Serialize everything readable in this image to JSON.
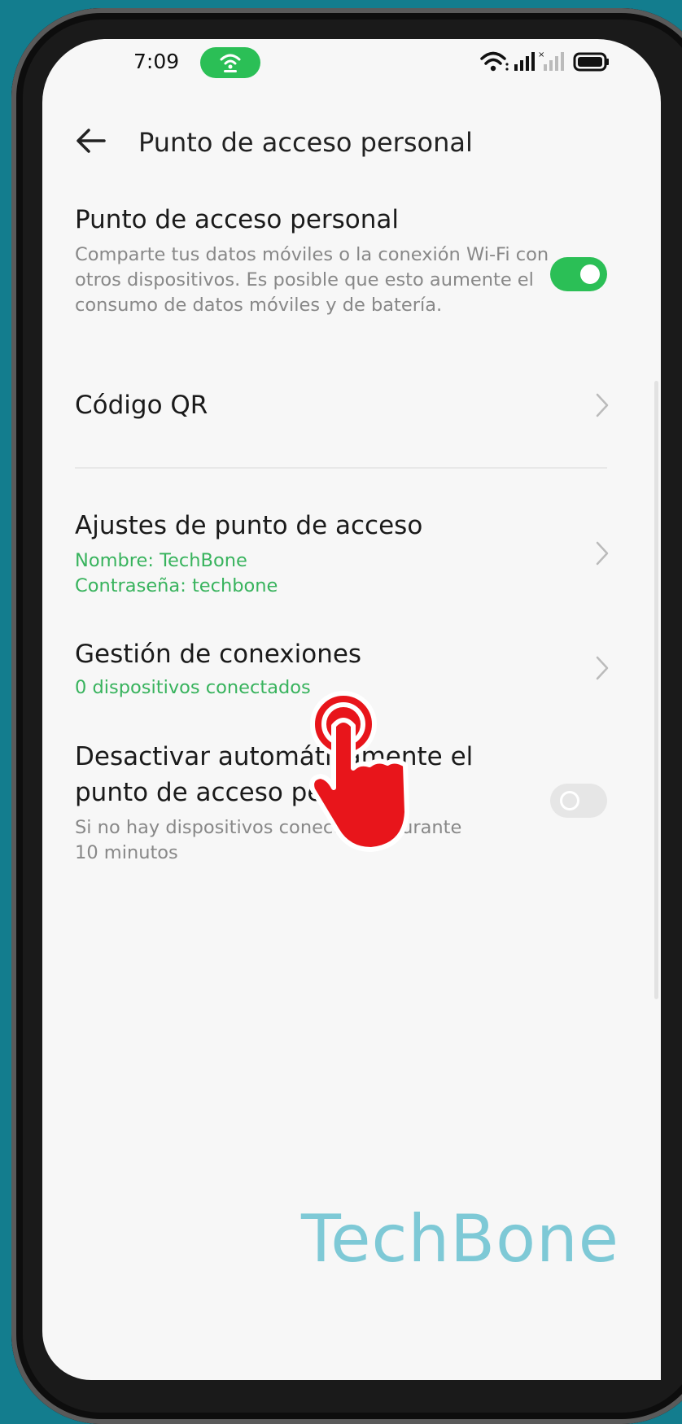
{
  "status_bar": {
    "time": "7:09",
    "hotspot_color": "#2bbf56"
  },
  "header": {
    "title": "Punto de acceso personal"
  },
  "hotspot_toggle_item": {
    "title": "Punto de acceso personal",
    "description": "Comparte tus datos móviles o la conexión Wi-Fi con otros dispositivos. Es posible que esto aumente el consumo de datos móviles y de batería.",
    "enabled": true
  },
  "qr_item": {
    "title": "Código QR"
  },
  "settings_item": {
    "title": "Ajustes de punto de acceso",
    "name_line": "Nombre: TechBone",
    "password_line": "Contraseña: techbone"
  },
  "connections_item": {
    "title": "Gestión de conexiones",
    "subtitle": "0 dispositivos conectados"
  },
  "auto_off_item": {
    "title": "Desactivar automáticamente el punto de acceso personal",
    "description": "Si no hay dispositivos conectados durante 10 minutos",
    "enabled": false
  },
  "watermark": "TechBone",
  "colors": {
    "accent": "#2bbf56",
    "subtitle_green": "#38b35d",
    "tap_indicator": "#e8151b",
    "background": "#137d8e"
  }
}
